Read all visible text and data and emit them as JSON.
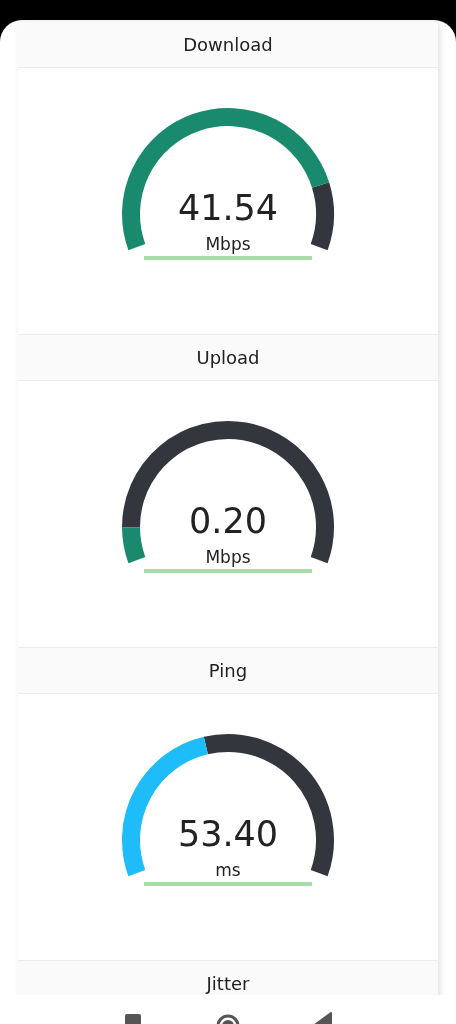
{
  "metrics": [
    {
      "title": "Download",
      "value": "41.54",
      "unit": "Mbps",
      "color": "#1a8a6e"
    },
    {
      "title": "Upload",
      "value": "0.20",
      "unit": "Mbps",
      "color": "#1a8a6e"
    },
    {
      "title": "Ping",
      "value": "53.40",
      "unit": "ms",
      "color": "#1ebcf8"
    },
    {
      "title": "Jitter"
    }
  ]
}
